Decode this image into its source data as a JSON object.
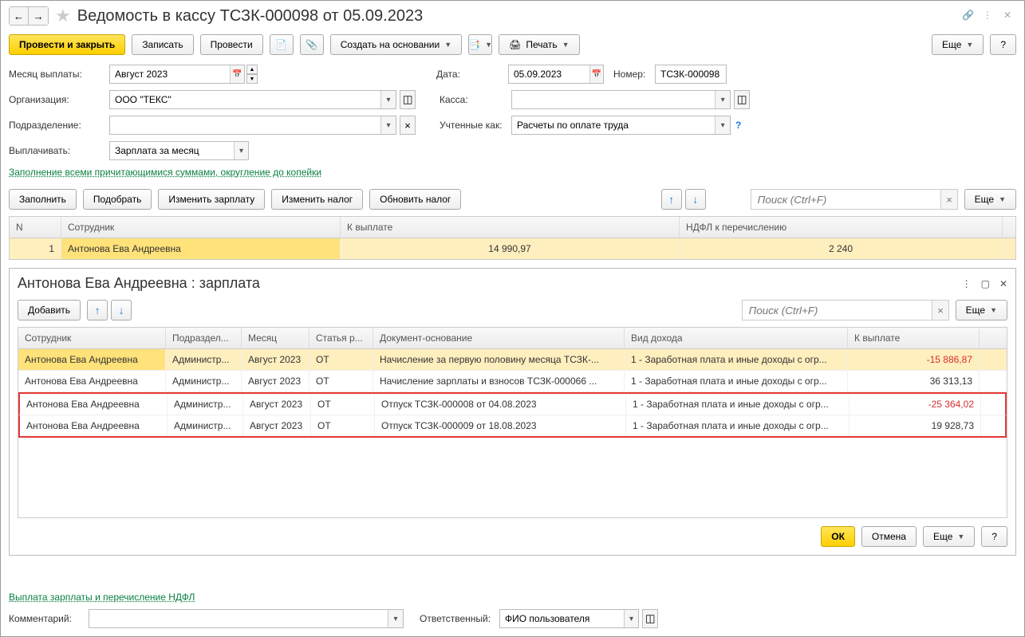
{
  "title": "Ведомость в кассу ТСЗК-000098 от 05.09.2023",
  "toolbar": {
    "post_close": "Провести и закрыть",
    "write": "Записать",
    "post": "Провести",
    "create_basis": "Создать на основании",
    "print": "Печать",
    "more": "Еще",
    "help": "?"
  },
  "form": {
    "month_label": "Месяц выплаты:",
    "month_value": "Август 2023",
    "date_label": "Дата:",
    "date_value": "05.09.2023",
    "number_label": "Номер:",
    "number_value": "ТСЗК-000098",
    "org_label": "Организация:",
    "org_value": "ООО \"ТЕКС\"",
    "kassa_label": "Касса:",
    "kassa_value": "",
    "dept_label": "Подразделение:",
    "dept_value": "",
    "accounted_label": "Учтенные как:",
    "accounted_value": "Расчеты по оплате труда",
    "pay_label": "Выплачивать:",
    "pay_value": "Зарплата за месяц",
    "fill_link": "Заполнение всеми причитающимися суммами, округление до копейки"
  },
  "section_toolbar": {
    "fill": "Заполнить",
    "pick": "Подобрать",
    "change_salary": "Изменить зарплату",
    "change_tax": "Изменить налог",
    "update_tax": "Обновить налог",
    "search_ph": "Поиск (Ctrl+F)",
    "more": "Еще"
  },
  "main_table": {
    "cols": {
      "n": "N",
      "emp": "Сотрудник",
      "pay": "К выплате",
      "ndfl": "НДФЛ к перечислению"
    },
    "row": {
      "n": "1",
      "emp": "Антонова Ева Андреевна",
      "pay": "14 990,97",
      "ndfl": "2 240"
    }
  },
  "detail": {
    "title": "Антонова Ева Андреевна : зарплата",
    "add": "Добавить",
    "search_ph": "Поиск (Ctrl+F)",
    "more": "Еще",
    "ok": "ОК",
    "cancel": "Отмена",
    "cols": {
      "emp": "Сотрудник",
      "dept": "Подраздел...",
      "month": "Месяц",
      "article": "Статья р...",
      "doc": "Документ-основание",
      "income": "Вид дохода",
      "pay": "К выплате"
    },
    "rows": [
      {
        "emp": "Антонова Ева Андреевна",
        "dept": "Администр...",
        "month": "Август 2023",
        "article": "ОТ",
        "doc": "Начисление за первую половину месяца ТСЗК-...",
        "income": "1 - Заработная плата и иные доходы с огр...",
        "pay": "-15 886,87",
        "neg": true
      },
      {
        "emp": "Антонова Ева Андреевна",
        "dept": "Администр...",
        "month": "Август 2023",
        "article": "ОТ",
        "doc": "Начисление зарплаты и взносов ТСЗК-000066 ...",
        "income": "1 - Заработная плата и иные доходы с огр...",
        "pay": "36 313,13",
        "neg": false
      },
      {
        "emp": "Антонова Ева Андреевна",
        "dept": "Администр...",
        "month": "Август 2023",
        "article": "ОТ",
        "doc": "Отпуск ТСЗК-000008 от 04.08.2023",
        "income": "1 - Заработная плата и иные доходы с огр...",
        "pay": "-25 364,02",
        "neg": true
      },
      {
        "emp": "Антонова Ева Андреевна",
        "dept": "Администр...",
        "month": "Август 2023",
        "article": "ОТ",
        "doc": "Отпуск ТСЗК-000009 от 18.08.2023",
        "income": "1 - Заработная плата и иные доходы с огр...",
        "pay": "19 928,73",
        "neg": false
      }
    ]
  },
  "footer": {
    "link": "Выплата зарплаты и перечисление НДФЛ",
    "comment_label": "Комментарий:",
    "resp_label": "Ответственный:",
    "resp_value": "ФИО пользователя"
  }
}
